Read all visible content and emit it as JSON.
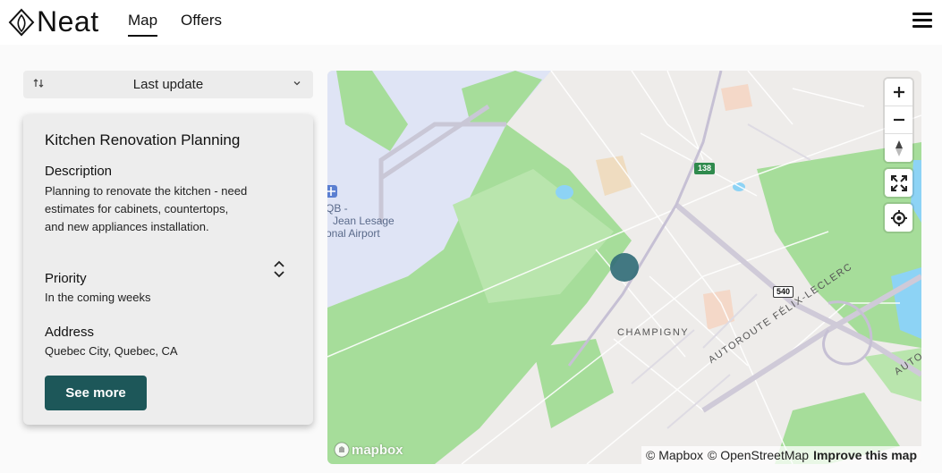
{
  "header": {
    "logo_text": "Neat",
    "tabs": [
      {
        "label": "Map",
        "active": true
      },
      {
        "label": "Offers",
        "active": false
      }
    ]
  },
  "sort": {
    "label": "Last update",
    "icon": "sort-arrows-icon"
  },
  "card": {
    "title": "Kitchen Renovation Planning",
    "description_label": "Description",
    "description": "Planning to renovate the kitchen - need estimates for cabinets, countertops, and new appliances installation.",
    "priority_label": "Priority",
    "priority": "In the coming weeks",
    "address_label": "Address",
    "address": "Quebec City, Quebec, CA",
    "button_label": "See more"
  },
  "map": {
    "labels": {
      "airport_line1": "QB -",
      "airport_line2": "Jean Lesage",
      "airport_line3": "onal Airport",
      "neighborhood": "CHAMPIGNY",
      "highway": "AUTOROUTE FÉLIX-LECLERC",
      "highway_cut": "AUTO",
      "shield_138": "138",
      "shield_540": "540"
    },
    "mapbox_logo": "mapbox",
    "attribution": {
      "mapbox": "© Mapbox",
      "osm": "© OpenStreetMap",
      "improve": "Improve this map"
    },
    "colors": {
      "marker": "#336e78",
      "park": "#a6dd9a",
      "airport": "#dfe4f5",
      "water": "#8dd3f5",
      "button": "#1d5759"
    }
  }
}
